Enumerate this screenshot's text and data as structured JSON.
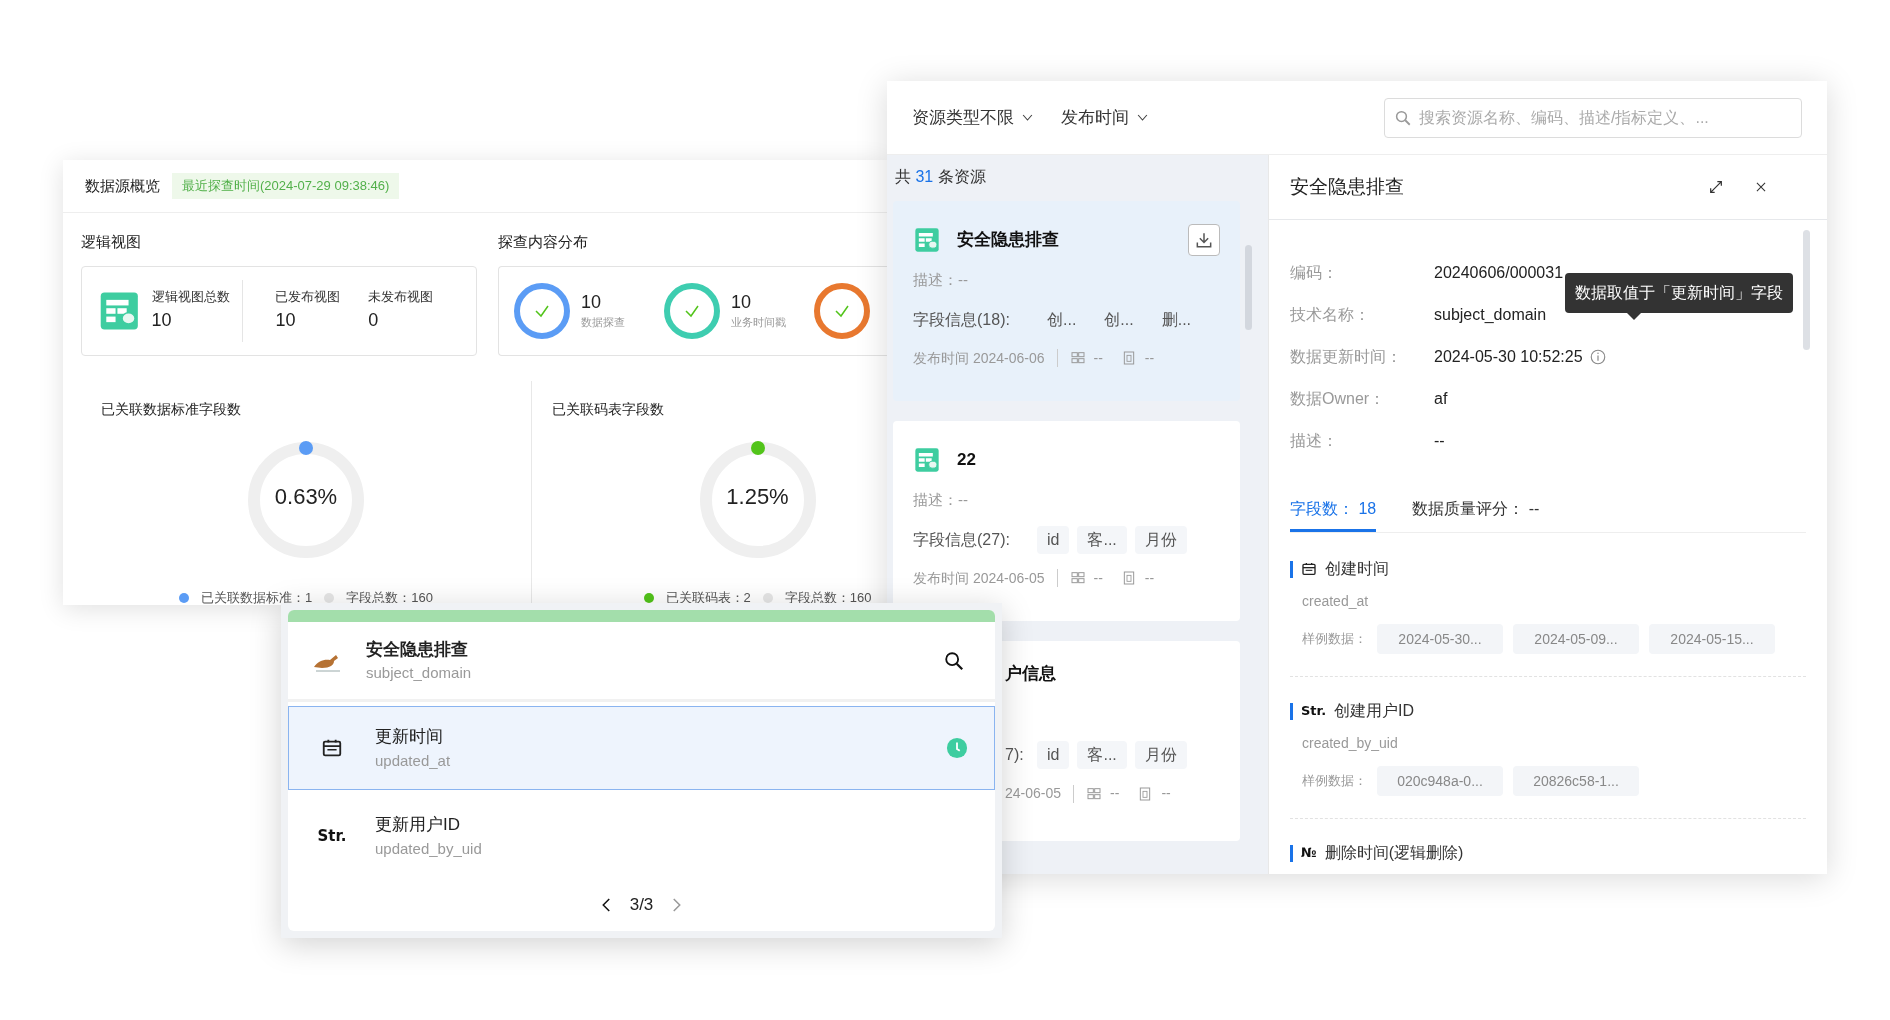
{
  "overview": {
    "title": "数据源概览",
    "probe_time": "最近探查时间(2024-07-29 09:38:46)",
    "logical_view": {
      "title": "逻辑视图",
      "total": {
        "label": "逻辑视图总数",
        "value": "10"
      },
      "stats": [
        {
          "label": "已发布视图",
          "value": "10"
        },
        {
          "label": "未发布视图",
          "value": "0"
        }
      ]
    },
    "distribution": {
      "title": "探查内容分布",
      "items": [
        {
          "value": "10",
          "label": "数据探查",
          "color": "#5b9cf5"
        },
        {
          "value": "10",
          "label": "业务时间戳",
          "color": "#3ecdb0"
        },
        {
          "color": "#e8782f"
        }
      ]
    },
    "linked": [
      {
        "title": "已关联数据标准字段数",
        "percent": "0.63%",
        "color": "#5b9cf5",
        "legend": [
          "已关联数据标准：1",
          "字段总数：160"
        ]
      },
      {
        "title": "已关联码表字段数",
        "percent": "1.25%",
        "color": "#52c41a",
        "legend": [
          "已关联码表：2",
          "字段总数：160"
        ]
      }
    ]
  },
  "resources": {
    "filters": [
      {
        "label": "资源类型不限"
      },
      {
        "label": "发布时间"
      }
    ],
    "search": {
      "placeholder": "搜索资源名称、编码、描述/指标定义、..."
    },
    "count_prefix": "共",
    "count": "31",
    "count_suffix": "条资源",
    "cards": [
      {
        "kind": "full",
        "selected": true,
        "title": "安全隐患排查",
        "desc_label": "描述：",
        "desc": "--",
        "fields_label": "字段信息(18):",
        "fields": [
          "创...",
          "创...",
          "删..."
        ],
        "published": "发布时间 2024-06-06",
        "meta": [
          "--",
          "--"
        ]
      },
      {
        "kind": "full",
        "selected": false,
        "title": "22",
        "desc_label": "描述：",
        "desc": "--",
        "fields_label": "字段信息(27):",
        "fields": [
          "id",
          "客...",
          "月份"
        ],
        "published": "发布时间 2024-06-05",
        "meta": [
          "--",
          "--"
        ]
      },
      {
        "kind": "clipped",
        "selected": false,
        "title": "户信息",
        "fields_label": "7):",
        "fields": [
          "id",
          "客...",
          "月份"
        ],
        "published": "24-06-05",
        "meta": [
          "--",
          "--"
        ]
      }
    ]
  },
  "detail": {
    "title": "安全隐患排查",
    "props": [
      {
        "label": "编码：",
        "value": "20240606/000031",
        "info": false
      },
      {
        "label": "技术名称：",
        "value": "subject_domain",
        "info": false
      },
      {
        "label": "数据更新时间：",
        "value": "2024-05-30 10:52:25",
        "info": true
      },
      {
        "label": "数据Owner：",
        "value": "af",
        "info": false
      },
      {
        "label": "描述：",
        "value": "--",
        "info": false
      }
    ],
    "tooltip": "数据取值于「更新时间」字段",
    "tabs": [
      {
        "label": "字段数：",
        "count": "18",
        "selected": true
      },
      {
        "label": "数据质量评分：",
        "count": "--",
        "selected": false
      }
    ],
    "fields": [
      {
        "kind": "date",
        "name": "创建时间",
        "tech": "created_at",
        "samples_label": "样例数据：",
        "samples": [
          "2024-05-30...",
          "2024-05-09...",
          "2024-05-15..."
        ]
      },
      {
        "kind": "string",
        "icon_text": "Str.",
        "name": "创建用户ID",
        "tech": "created_by_uid",
        "samples_label": "样例数据：",
        "samples": [
          "020c948a-0...",
          "20826c58-1..."
        ]
      },
      {
        "kind": "number",
        "icon_text": "№",
        "name": "删除时间(逻辑删除)"
      }
    ]
  },
  "popup": {
    "source": {
      "title": "安全隐患排查",
      "tech": "subject_domain"
    },
    "rows": [
      {
        "kind": "date",
        "name": "更新时间",
        "tech": "updated_at",
        "selected": true
      },
      {
        "kind": "string",
        "icon_text": "Str.",
        "name": "更新用户ID",
        "tech": "updated_by_uid",
        "selected": false
      }
    ],
    "page": "3/3"
  }
}
